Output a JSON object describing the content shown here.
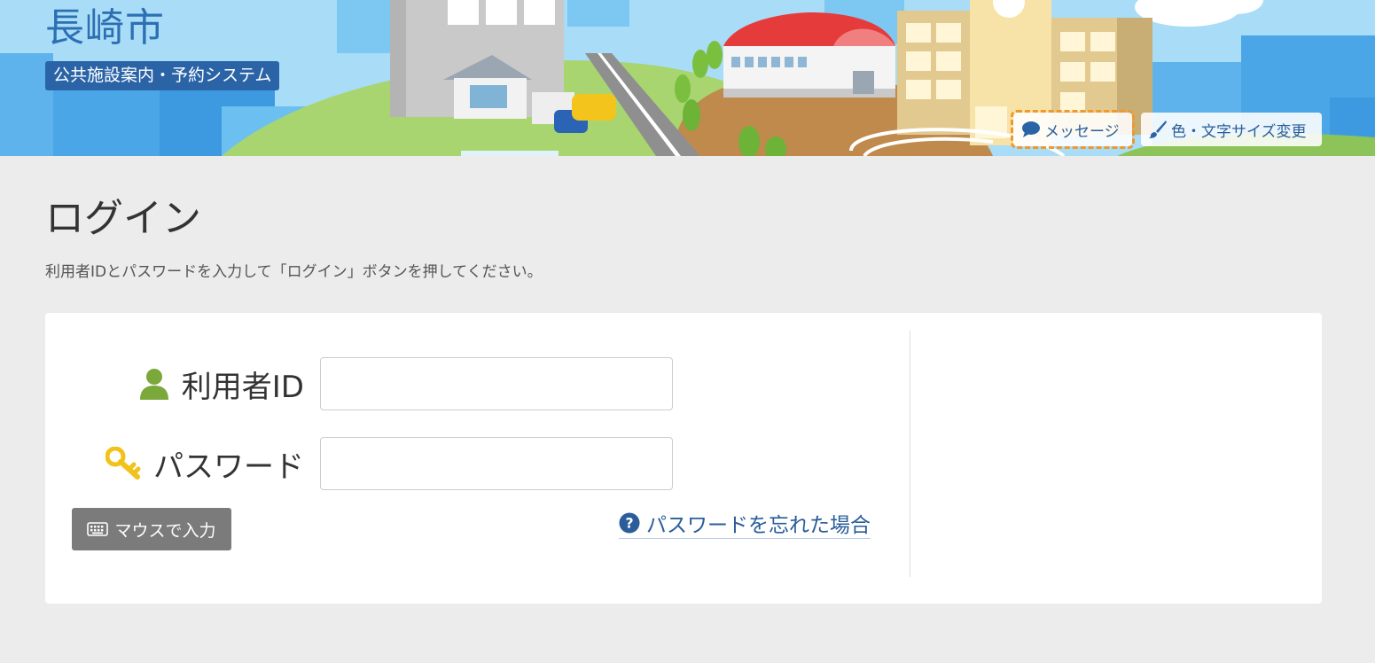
{
  "header": {
    "city_name": "長崎市",
    "system_name": "公共施設案内・予約システム",
    "message_button": {
      "label": "メッセージ",
      "icon": "speech-bubble-icon"
    },
    "display_settings_button": {
      "label": "色・文字サイズ変更",
      "icon": "paintbrush-icon"
    }
  },
  "page": {
    "title": "ログイン",
    "instructions": "利用者IDとパスワードを入力して「ログイン」ボタンを押してください。"
  },
  "form": {
    "user_id": {
      "label": "利用者ID",
      "value": "",
      "icon": "person-icon"
    },
    "password": {
      "label": "パスワード",
      "value": "",
      "icon": "key-icon"
    },
    "mouse_input_button": {
      "label": "マウスで入力",
      "icon": "keyboard-icon"
    },
    "forgot_password_link": {
      "label": "パスワードを忘れた場合",
      "icon": "question-circle-icon"
    }
  },
  "colors": {
    "brand_blue": "#2a64a6",
    "link_blue": "#2a5d99",
    "focus_outline": "#f0982b",
    "user_icon_green": "#7aa83a",
    "key_icon_yellow": "#f2c21b",
    "page_background": "#ececec"
  }
}
